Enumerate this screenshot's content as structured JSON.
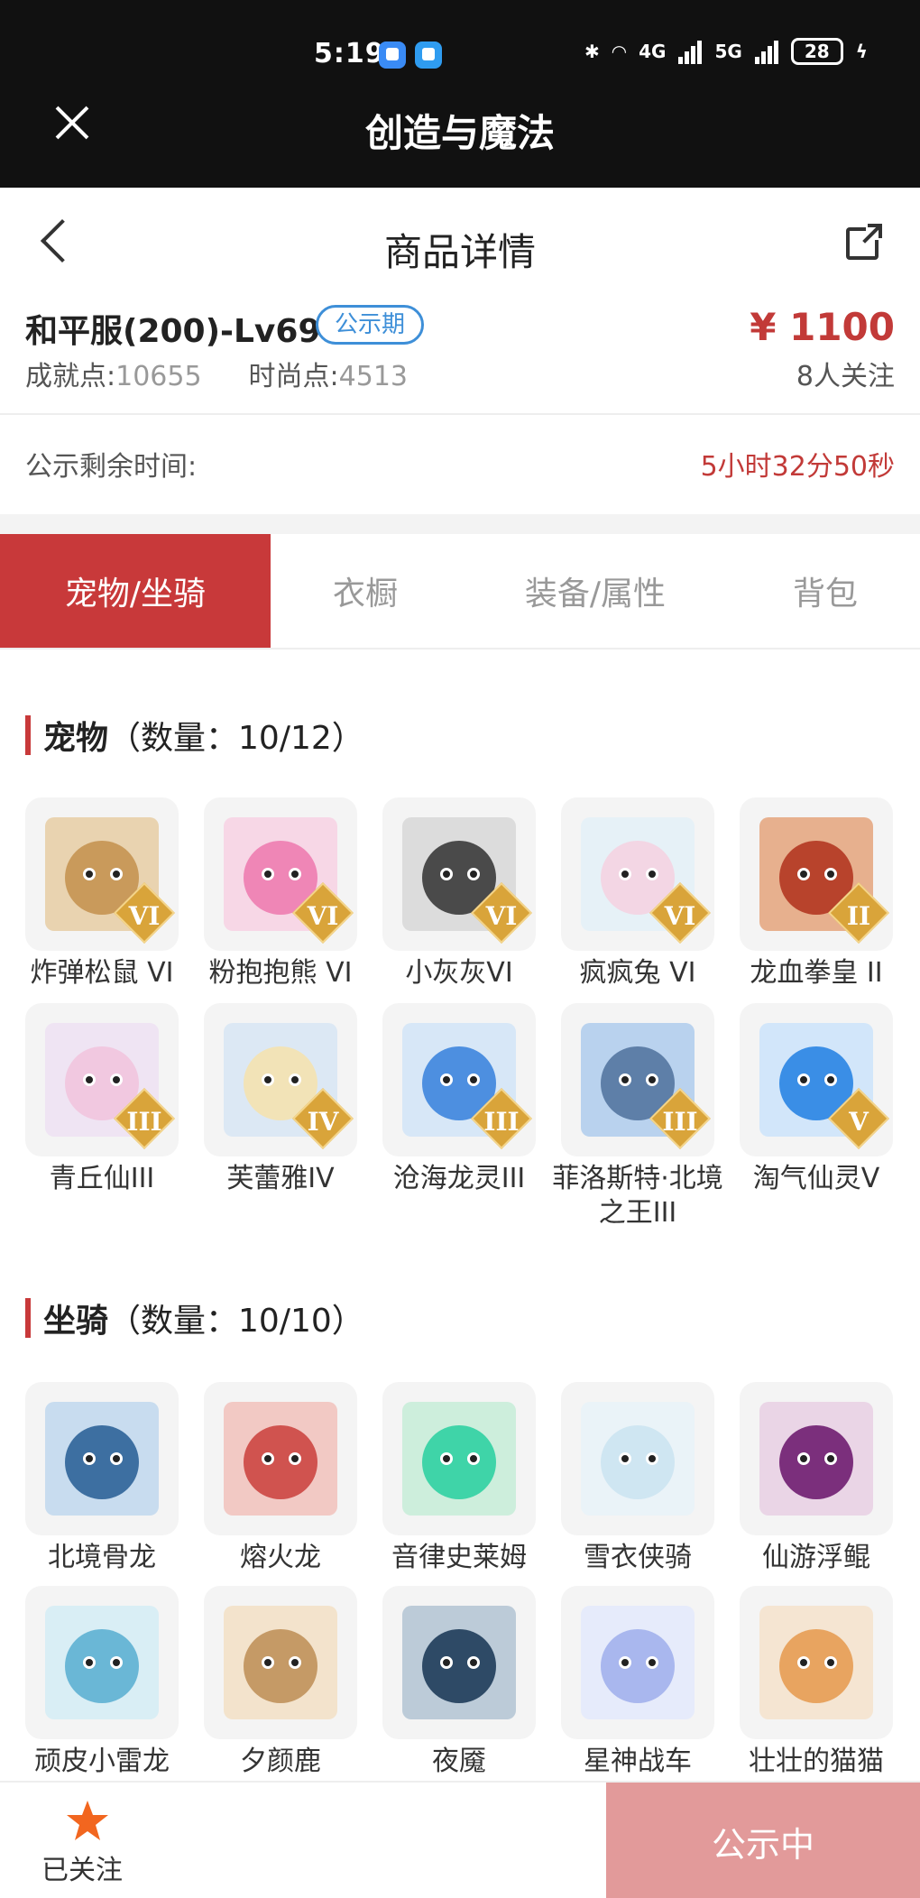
{
  "status_bar": {
    "time": "5:19",
    "network_1": "4G",
    "network_2": "5G",
    "battery": "28"
  },
  "app": {
    "title": "创造与魔法"
  },
  "nav": {
    "title": "商品详情"
  },
  "product": {
    "name": "和平服(200)-Lv69",
    "badge": "公示期",
    "achievement_label": "成就点:",
    "achievement_value": "10655",
    "fashion_label": "时尚点:",
    "fashion_value": "4513",
    "price": "¥ 1100",
    "followers": "8人关注"
  },
  "remaining": {
    "label": "公示剩余时间:",
    "value": "5小时32分50秒"
  },
  "tabs": [
    {
      "label": "宠物/坐骑",
      "active": true
    },
    {
      "label": "衣橱",
      "active": false
    },
    {
      "label": "装备/属性",
      "active": false
    },
    {
      "label": "背包",
      "active": false
    }
  ],
  "pets": {
    "title": "宠物",
    "count": "（数量：10/12）",
    "items": [
      {
        "name": "炸弹松鼠 VI",
        "tier": "VI",
        "color": "#c99a5b",
        "bg": "#e9d3b0",
        "icon": "squirrel-icon"
      },
      {
        "name": "粉抱抱熊 VI",
        "tier": "VI",
        "color": "#ef86b6",
        "bg": "#f7d7e6",
        "icon": "bear-icon"
      },
      {
        "name": "小灰灰VI",
        "tier": "VI",
        "color": "#4a4a4a",
        "bg": "#dcdcdc",
        "icon": "wolf-icon"
      },
      {
        "name": "疯疯兔 VI",
        "tier": "VI",
        "color": "#f3d6e4",
        "bg": "#e6f1f7",
        "icon": "rabbit-icon"
      },
      {
        "name": "龙血拳皇 II",
        "tier": "II",
        "color": "#b8432c",
        "bg": "#e7b08e",
        "icon": "dragon-fighter-icon"
      },
      {
        "name": "青丘仙III",
        "tier": "III",
        "color": "#f1c8e0",
        "bg": "#efe4f3",
        "icon": "fox-fairy-icon"
      },
      {
        "name": "芙蕾雅IV",
        "tier": "IV",
        "color": "#f2e3b7",
        "bg": "#dce8f4",
        "icon": "freya-icon"
      },
      {
        "name": "沧海龙灵III",
        "tier": "III",
        "color": "#4d8fe0",
        "bg": "#d7e7f7",
        "icon": "sea-dragon-icon"
      },
      {
        "name": "菲洛斯特·北境之王III",
        "tier": "III",
        "color": "#5e7fa8",
        "bg": "#b9d2ee",
        "icon": "north-king-icon"
      },
      {
        "name": "淘气仙灵V",
        "tier": "V",
        "color": "#3a8ee6",
        "bg": "#d2e6fa",
        "icon": "sprite-icon"
      }
    ]
  },
  "mounts": {
    "title": "坐骑",
    "count": "（数量：10/10）",
    "items": [
      {
        "name": "北境骨龙",
        "color": "#3d6fa1",
        "bg": "#c8dcef",
        "icon": "bone-dragon-icon"
      },
      {
        "name": "熔火龙",
        "color": "#d0534f",
        "bg": "#f2c9c4",
        "icon": "fire-dragon-icon"
      },
      {
        "name": "音律史莱姆",
        "color": "#3fd4a8",
        "bg": "#cdeedc",
        "icon": "slime-icon"
      },
      {
        "name": "雪衣侠骑",
        "color": "#cfe6f2",
        "bg": "#eaf3f8",
        "icon": "white-horse-icon"
      },
      {
        "name": "仙游浮鲲",
        "color": "#7b2f7c",
        "bg": "#ead5e6",
        "icon": "whale-icon"
      },
      {
        "name": "顽皮小雷龙",
        "color": "#6ab7d6",
        "bg": "#d9eef5",
        "icon": "thunder-dragon-icon"
      },
      {
        "name": "夕颜鹿",
        "color": "#c59a66",
        "bg": "#f3e3cc",
        "icon": "deer-icon"
      },
      {
        "name": "夜魇",
        "color": "#2e4a66",
        "bg": "#bccbd8",
        "icon": "nightmare-horse-icon"
      },
      {
        "name": "星神战车",
        "color": "#a9b7ee",
        "bg": "#e6ebfb",
        "icon": "star-chariot-icon"
      },
      {
        "name": "壮壮的猫猫",
        "color": "#e8a460",
        "bg": "#f5e5d2",
        "icon": "cat-icon"
      }
    ]
  },
  "bottom": {
    "followed_label": "已关注",
    "action_label": "公示中"
  },
  "colors": {
    "accent": "#c8393a",
    "price": "#c23a38",
    "badge": "#3e8fd8",
    "cta": "#e29a9a",
    "star": "#f2661f"
  }
}
